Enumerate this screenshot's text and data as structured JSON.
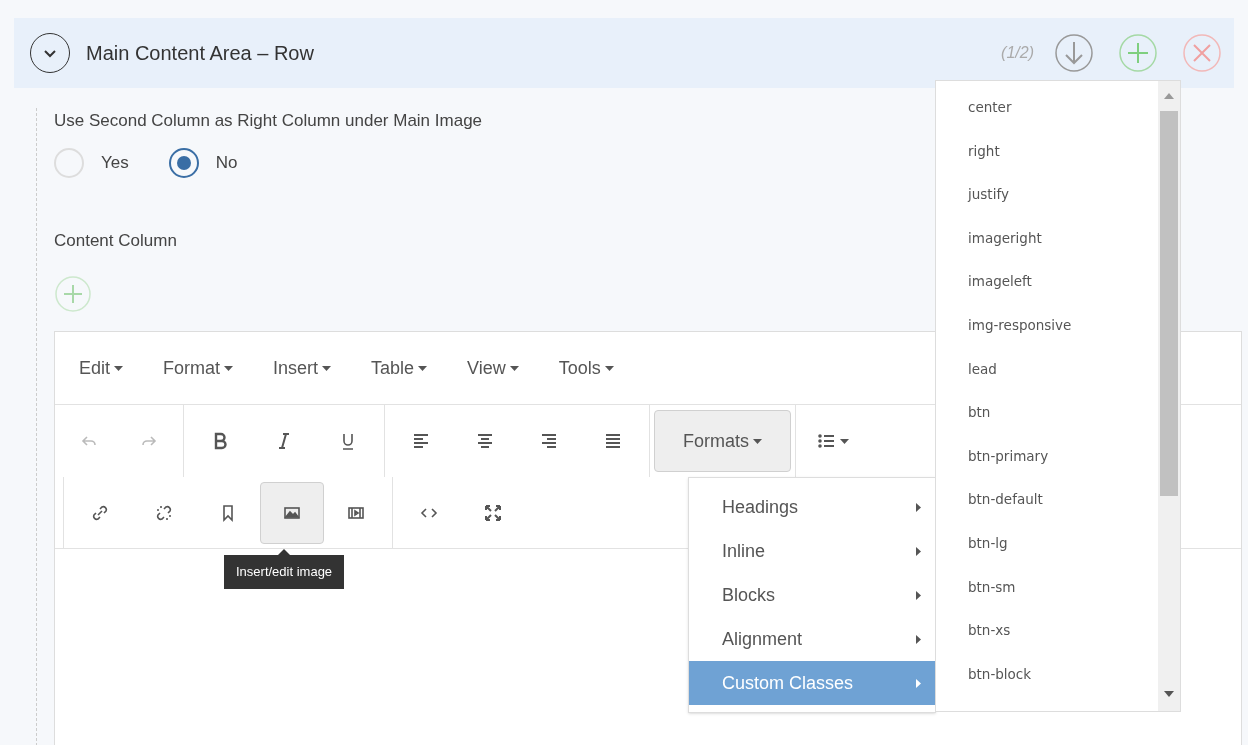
{
  "panel": {
    "title": "Main Content Area – Row",
    "expanded": true,
    "counter": "(1/2)"
  },
  "option": {
    "label": "Use Second Column as Right Column under Main Image",
    "choices": [
      {
        "label": "Yes",
        "selected": false
      },
      {
        "label": "No",
        "selected": true
      }
    ]
  },
  "column": {
    "label": "Content Column"
  },
  "editor": {
    "menubar": [
      "Edit",
      "Format",
      "Insert",
      "Table",
      "View",
      "Tools"
    ],
    "toolbar": {
      "undo_disabled": true,
      "redo_disabled": true,
      "image_active": true,
      "formats": {
        "label": "Formats",
        "open": true
      }
    },
    "tooltip": "Insert/edit image",
    "formats_menu": [
      {
        "label": "Headings",
        "selected": false
      },
      {
        "label": "Inline",
        "selected": false
      },
      {
        "label": "Blocks",
        "selected": false
      },
      {
        "label": "Alignment",
        "selected": false
      },
      {
        "label": "Custom Classes",
        "selected": true
      }
    ],
    "classes": [
      "center",
      "right",
      "justify",
      "imageright",
      "imageleft",
      "img-responsive",
      "lead",
      "btn",
      "btn-primary",
      "btn-default",
      "btn-lg",
      "btn-sm",
      "btn-xs",
      "btn-block"
    ]
  }
}
